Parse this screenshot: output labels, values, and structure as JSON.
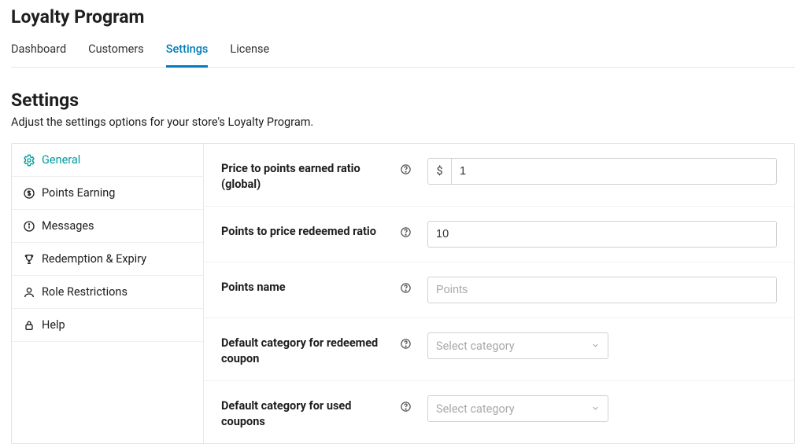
{
  "header": {
    "title": "Loyalty Program"
  },
  "tabs": [
    {
      "label": "Dashboard"
    },
    {
      "label": "Customers"
    },
    {
      "label": "Settings"
    },
    {
      "label": "License"
    }
  ],
  "active_tab_index": 2,
  "section": {
    "heading": "Settings",
    "subtitle": "Adjust the settings options for your store's Loyalty Program."
  },
  "sidebar": {
    "items": [
      {
        "label": "General"
      },
      {
        "label": "Points Earning"
      },
      {
        "label": "Messages"
      },
      {
        "label": "Redemption & Expiry"
      },
      {
        "label": "Role Restrictions"
      },
      {
        "label": "Help"
      }
    ],
    "active_index": 0
  },
  "form": {
    "price_points_ratio": {
      "label": "Price to points earned ratio (global)",
      "prefix": "$",
      "value": "1"
    },
    "points_price_ratio": {
      "label": "Points to price redeemed ratio",
      "value": "10"
    },
    "points_name": {
      "label": "Points name",
      "placeholder": "Points",
      "value": ""
    },
    "default_category_redeemed": {
      "label": "Default category for redeemed coupon",
      "placeholder": "Select category"
    },
    "default_category_used": {
      "label": "Default category for used coupons",
      "placeholder": "Select category"
    }
  }
}
